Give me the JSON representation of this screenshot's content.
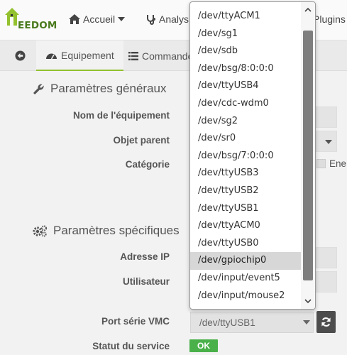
{
  "brand": {
    "logo_text": "EEDOM",
    "accent": "#94c12f"
  },
  "nav": {
    "home": {
      "label": "Accueil",
      "icon": "home-icon"
    },
    "analysis": {
      "label": "Analys",
      "icon": "stethoscope-icon"
    },
    "plugins": {
      "label": "Plugins"
    }
  },
  "tabs": {
    "back": {
      "icon": "arrow-circle-left-icon"
    },
    "equipment": {
      "label": "Equipement",
      "icon": "dashboard-icon"
    },
    "commands": {
      "label": "Commande",
      "icon": "list-icon"
    }
  },
  "general": {
    "title": "Paramètres généraux",
    "name_label": "Nom de l'équipement",
    "parent_label": "Objet parent",
    "category_label": "Catégorie",
    "category_option": "Ene"
  },
  "specific": {
    "title": "Paramètres spécifiques",
    "ip_label": "Adresse IP",
    "user_label": "Utilisateur",
    "port_label": "Port série VMC",
    "port_value": "/dev/ttyUSB1",
    "status_label": "Statut du service",
    "status_value": "OK",
    "status_color": "#4ab14a"
  },
  "dropdown": {
    "options": [
      "/dev/ttyACM1",
      "/dev/sg1",
      "/dev/sdb",
      "/dev/bsg/8:0:0:0",
      "/dev/ttyUSB4",
      "/dev/cdc-wdm0",
      "/dev/sg2",
      "/dev/sr0",
      "/dev/bsg/7:0:0:0",
      "/dev/ttyUSB3",
      "/dev/ttyUSB2",
      "/dev/ttyUSB1",
      "/dev/ttyACM0",
      "/dev/ttyUSB0",
      "/dev/gpiochip0",
      "/dev/input/event5",
      "/dev/input/mouse2"
    ],
    "highlighted": "/dev/gpiochip0"
  }
}
